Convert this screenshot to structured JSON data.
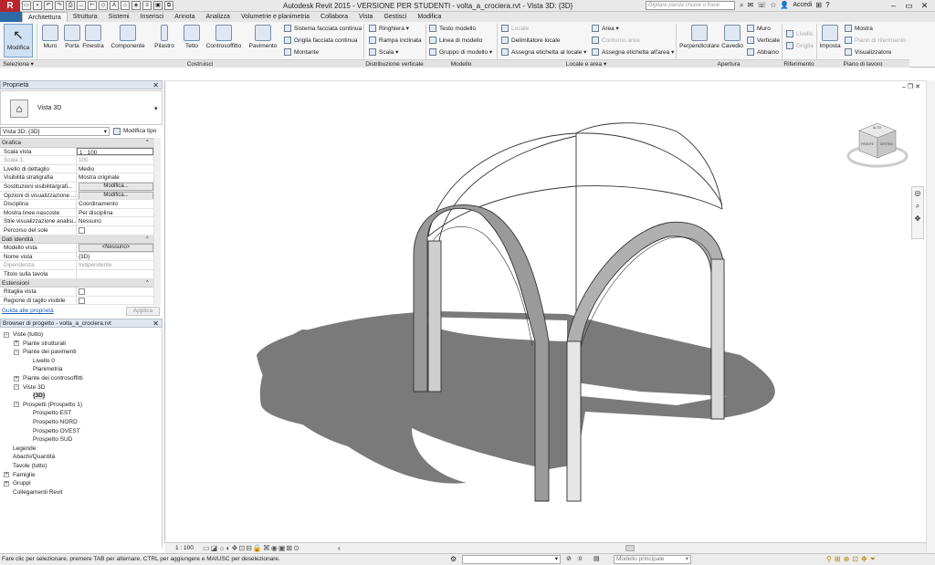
{
  "app": {
    "logo": "R",
    "window_title": "Autodesk Revit 2015 - VERSIONE PER STUDENTI  -    volta_a_crociera.rvt - Vista 3D: {3D}",
    "search_placeholder": "Digitare parola chiave o frase",
    "signin_label": "Accedi"
  },
  "tabs": [
    "Architettura",
    "Struttura",
    "Sistemi",
    "Inserisci",
    "Annota",
    "Analizza",
    "Volumetrie e planimetria",
    "Collabora",
    "Vista",
    "Gestisci",
    "Modifica"
  ],
  "ribbon": {
    "modify": "Modifica",
    "select": "Seleziona ▾",
    "build": {
      "wall": "Muro",
      "door": "Porta",
      "window": "Finestra",
      "component": "Componente",
      "column": "Pilastro",
      "roof": "Tetto",
      "ceiling": "Controsoffitto",
      "floor": "Pavimento",
      "curtain_system": "Sistema facciata continua",
      "curtain_grid": "Griglia facciata continua",
      "mullion": "Montante",
      "label": "Costruisci"
    },
    "circulation": {
      "railing": "Ringhiera ▾",
      "ramp": "Rampa inclinata",
      "stair": "Scala ▾",
      "label": "Distribuzione verticale"
    },
    "model": {
      "model_text": "Testo modello",
      "model_line": "Linea di modello",
      "model_group": "Gruppo di modello ▾",
      "label": "Modello"
    },
    "room_area": {
      "room": "Locale",
      "room_separator": "Delimitatore  locale",
      "tag_room": "Assegna etichetta  al locale ▾",
      "area": "Area ▾",
      "area_boundary": "Contorno  area",
      "tag_area": "Assegna etichetta  all'area ▾",
      "label": "Locale e area ▾"
    },
    "opening": {
      "by_face": "Perpendicolare",
      "shaft": "Cavedio",
      "wall": "Muro",
      "vertical": "Verticale",
      "dormer": "Abbaino",
      "label": "Apertura"
    },
    "datum": {
      "level": "Livello",
      "grid": "Griglia",
      "label": "Riferimento"
    },
    "work_plane": {
      "set": "Imposta",
      "show": "Mostra",
      "ref_plane": "Piano di riferimento",
      "viewer": "Visualizzatore",
      "label": "Piano di lavoro"
    }
  },
  "properties": {
    "title": "Proprietà",
    "type_name": "Vista 3D",
    "instance_selector": "Vista 3D: {3D}",
    "edit_type": "Modifica tipo",
    "sections": [
      {
        "name": "Grafica",
        "rows": [
          {
            "k": "Scala vista",
            "v": "1 : 100",
            "kind": "input"
          },
          {
            "k": "Scala  1:",
            "v": "100",
            "kind": "dis"
          },
          {
            "k": "Livello di dettaglio",
            "v": "Medio"
          },
          {
            "k": "Visibilità stratigrafia",
            "v": "Mostra originale"
          },
          {
            "k": "Sostituzioni visibilità/grafi...",
            "v": "Modifica...",
            "kind": "button"
          },
          {
            "k": "Opzioni di visualizzazione ...",
            "v": "Modifica...",
            "kind": "button"
          },
          {
            "k": "Disciplina",
            "v": "Coordinamento"
          },
          {
            "k": "Mostra linee nascoste",
            "v": "Per disciplina"
          },
          {
            "k": "Stile visualizzazione analisi...",
            "v": "Nessuno"
          },
          {
            "k": "Percorso del sole",
            "v": "",
            "kind": "check"
          }
        ]
      },
      {
        "name": "Dati identità",
        "rows": [
          {
            "k": "Modello vista",
            "v": "<Nessuno>",
            "kind": "button"
          },
          {
            "k": "Nome vista",
            "v": "{3D}"
          },
          {
            "k": "Dipendenza",
            "v": "Indipendente",
            "kind": "dis"
          },
          {
            "k": "Titolo sulla tavola",
            "v": ""
          }
        ]
      },
      {
        "name": "Estensioni",
        "rows": [
          {
            "k": "Ritaglia vista",
            "v": "",
            "kind": "check"
          },
          {
            "k": "Regione di taglio visibile",
            "v": "",
            "kind": "check"
          }
        ]
      }
    ],
    "help_link": "Guida alle proprietà",
    "apply": "Applica"
  },
  "browser": {
    "title": "Browser di progetto - volta_a_crociera.rvt",
    "nodes": [
      {
        "label": "Viste (tutto)",
        "indent": 0,
        "toggle": "−"
      },
      {
        "label": "Piante strutturali",
        "indent": 1,
        "toggle": "+"
      },
      {
        "label": "Piante dei pavimenti",
        "indent": 1,
        "toggle": "−"
      },
      {
        "label": "Livello 0",
        "indent": 2,
        "toggle": ""
      },
      {
        "label": "Planimetria",
        "indent": 2,
        "toggle": ""
      },
      {
        "label": "Piante dei controsoffitti",
        "indent": 1,
        "toggle": "+"
      },
      {
        "label": "Viste 3D",
        "indent": 1,
        "toggle": "−"
      },
      {
        "label": "{3D}",
        "indent": 2,
        "toggle": "",
        "bold": true
      },
      {
        "label": "Prospetti (Prospetto 1)",
        "indent": 1,
        "toggle": "−"
      },
      {
        "label": "Prospetto EST",
        "indent": 2,
        "toggle": ""
      },
      {
        "label": "Prospetto NORD",
        "indent": 2,
        "toggle": ""
      },
      {
        "label": "Prospetto OVEST",
        "indent": 2,
        "toggle": ""
      },
      {
        "label": "Prospetto SUD",
        "indent": 2,
        "toggle": ""
      },
      {
        "label": "Legende",
        "indent": 0,
        "toggle": ""
      },
      {
        "label": "Abachi/Quantità",
        "indent": 0,
        "toggle": ""
      },
      {
        "label": "Tavole (tutto)",
        "indent": 0,
        "toggle": ""
      },
      {
        "label": "Famiglie",
        "indent": 0,
        "toggle": "+"
      },
      {
        "label": "Gruppi",
        "indent": 0,
        "toggle": "+"
      },
      {
        "label": "Collegamenti Revit",
        "indent": 0,
        "toggle": ""
      }
    ]
  },
  "view": {
    "scale": "1 : 100",
    "viewcube_top": "ALTO",
    "viewcube_left": "FRONTE",
    "viewcube_right": "DESTRA"
  },
  "status": {
    "hint": "Fare clic per selezionare, premere TAB per alternare, CTRL per aggiungere e MAIUSC per deselezionare.",
    "main_model": "Modello principale",
    "selection_count": ":0"
  },
  "colors": {
    "revit_red": "#b8252d",
    "tab_blue": "#2d6ba6",
    "shadow": "#7a7a7a",
    "panel_title_bg": "#dfe6ee"
  }
}
